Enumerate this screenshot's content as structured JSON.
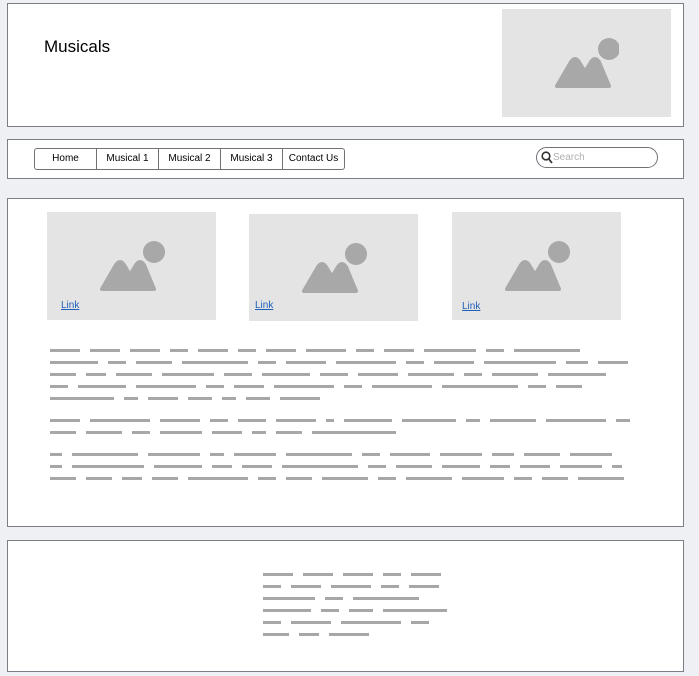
{
  "header": {
    "title": "Musicals",
    "image": "image-placeholder-icon"
  },
  "nav": {
    "items": [
      {
        "label": "Home"
      },
      {
        "label": "Musical 1"
      },
      {
        "label": "Musical 2"
      },
      {
        "label": "Musical 3"
      },
      {
        "label": "Contact Us"
      }
    ],
    "search": {
      "placeholder": "Search",
      "icon": "search-icon"
    }
  },
  "cards": [
    {
      "link": "Link",
      "image": "image-placeholder-icon"
    },
    {
      "link": "Link",
      "image": "image-placeholder-icon"
    },
    {
      "link": "Link",
      "image": "image-placeholder-icon"
    }
  ],
  "colors": {
    "placeholder_bg": "#e4e4e4",
    "placeholder_icon": "#a8a8a8",
    "link": "#1f5fb8",
    "text_bar": "#a7a7a7",
    "border": "#7b7f85"
  }
}
